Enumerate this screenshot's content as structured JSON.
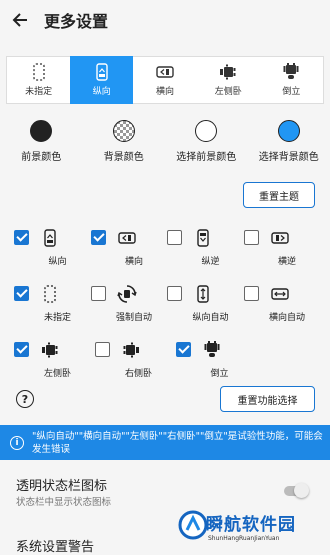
{
  "header": {
    "title": "更多设置",
    "back_icon": "arrow-left-icon"
  },
  "orientation_tabs": [
    {
      "label": "未指定",
      "icon": "phone-dashed-icon",
      "selected": false
    },
    {
      "label": "纵向",
      "icon": "phone-portrait-icon",
      "selected": true
    },
    {
      "label": "横向",
      "icon": "phone-landscape-icon",
      "selected": false
    },
    {
      "label": "左侧卧",
      "icon": "robot-left-icon",
      "selected": false
    },
    {
      "label": "倒立",
      "icon": "robot-upside-icon",
      "selected": false
    }
  ],
  "colors": [
    {
      "label": "前景颜色",
      "swatch": "#222222"
    },
    {
      "label": "背景颜色",
      "swatch": "checker"
    },
    {
      "label": "选择前景颜色",
      "swatch": "#ffffff"
    },
    {
      "label": "选择背景颜色",
      "swatch": "#2196f3"
    }
  ],
  "reset_theme_label": "重置主题",
  "options": [
    [
      {
        "label": "纵向",
        "checked": true,
        "icon": "phone-portrait-icon"
      },
      {
        "label": "横向",
        "checked": true,
        "icon": "phone-landscape-icon"
      },
      {
        "label": "纵逆",
        "checked": false,
        "icon": "phone-reverse-portrait-icon"
      },
      {
        "label": "横逆",
        "checked": false,
        "icon": "phone-reverse-landscape-icon"
      }
    ],
    [
      {
        "label": "未指定",
        "checked": true,
        "icon": "phone-dashed-icon"
      },
      {
        "label": "强制自动",
        "checked": false,
        "icon": "rotate-arrows-icon"
      },
      {
        "label": "纵向自动",
        "checked": false,
        "icon": "portrait-auto-icon"
      },
      {
        "label": "横向自动",
        "checked": false,
        "icon": "landscape-auto-icon"
      }
    ],
    [
      {
        "label": "左侧卧",
        "checked": true,
        "icon": "robot-left-icon"
      },
      {
        "label": "右侧卧",
        "checked": false,
        "icon": "robot-right-icon"
      },
      {
        "label": "倒立",
        "checked": true,
        "icon": "robot-upside-icon"
      }
    ]
  ],
  "reset_function_label": "重置功能选择",
  "help_glyph": "?",
  "banner": {
    "text": "\"纵向自动\"\"横向自动\"\"左侧卧\"\"右侧卧\"\"倒立\"是试验性功能，可能会发生错误",
    "accent": "#1e88e5"
  },
  "status_bar": {
    "title": "透明状态栏图标",
    "subtitle": "状态栏中显示状态图标",
    "enabled": false
  },
  "system_warning": {
    "title": "系统设置警告"
  },
  "watermark": {
    "main": "瞬航软件园",
    "sub": "ShunHangRuanJianYuan"
  }
}
